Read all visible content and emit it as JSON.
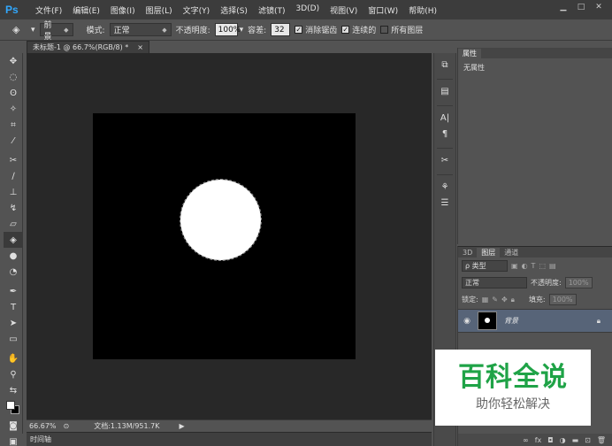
{
  "app": {
    "logo": "Ps"
  },
  "menu": [
    "文件(F)",
    "编辑(E)",
    "图像(I)",
    "图层(L)",
    "文字(Y)",
    "选择(S)",
    "滤镜(T)",
    "3D(D)",
    "视图(V)",
    "窗口(W)",
    "帮助(H)"
  ],
  "window_controls": {
    "minimize": "▁",
    "restore": "□",
    "close": "✕"
  },
  "options": {
    "fill_source": "前景",
    "mode_label": "模式:",
    "mode_value": "正常",
    "opacity_label": "不透明度:",
    "opacity_value": "100%",
    "tolerance_label": "容差:",
    "tolerance_value": "32",
    "antialias_label": "消除锯齿",
    "contiguous_label": "连续的",
    "all_layers_label": "所有图层"
  },
  "document": {
    "tab_title": "未标题-1 @ 66.7%(RGB/8) *",
    "tab_close": "×"
  },
  "status": {
    "zoom": "66.67%",
    "doc_info": "文档:1.13M/951.7K",
    "arrow": "▶"
  },
  "timeline_label": "时间轴",
  "properties": {
    "tab": "属性",
    "body": "无属性"
  },
  "layers": {
    "tabs": [
      "3D",
      "图层",
      "通道"
    ],
    "filter_kind": "ρ 类型",
    "blend_mode": "正常",
    "opacity_label": "不透明度:",
    "opacity_value": "100%",
    "lock_label": "锁定:",
    "fill_label": "填充:",
    "fill_value": "100%",
    "layer_name": "背景"
  },
  "watermark": {
    "title": "百科全说",
    "subtitle": "助你轻松解决"
  },
  "colors": {
    "accent_ps": "#31a8ff",
    "layer_selected": "#576478",
    "watermark_green": "#1fa347"
  }
}
